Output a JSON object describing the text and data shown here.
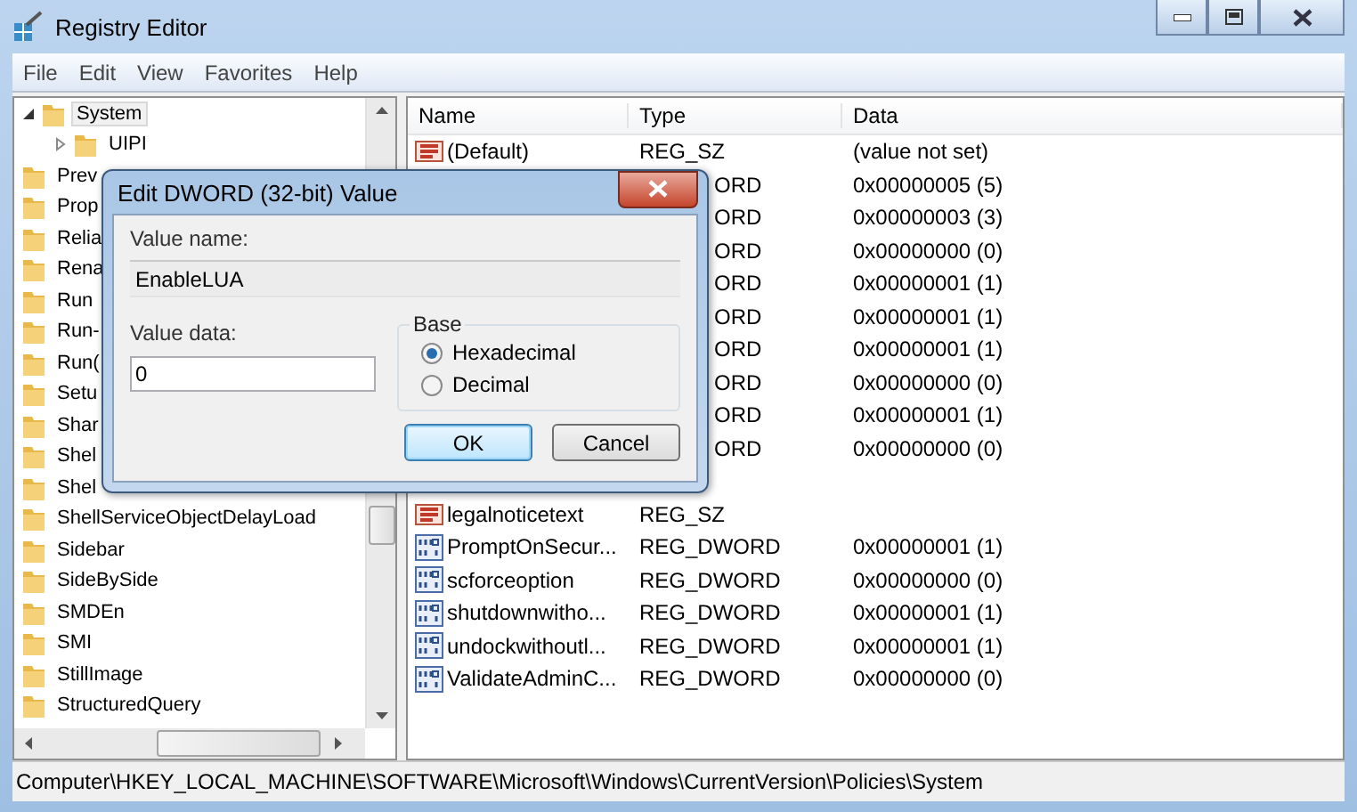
{
  "window": {
    "title": "Registry Editor"
  },
  "menu": [
    "File",
    "Edit",
    "View",
    "Favorites",
    "Help"
  ],
  "tree": {
    "items": [
      {
        "label": "System",
        "selected": true,
        "expanded": true,
        "children": [
          {
            "label": "UIPI",
            "selected": false,
            "expanded": false
          }
        ]
      },
      {
        "label": "Prev",
        "selected": false
      },
      {
        "label": "Prop",
        "selected": false
      },
      {
        "label": "Relia",
        "selected": false
      },
      {
        "label": "Rena",
        "selected": false
      },
      {
        "label": "Run",
        "selected": false
      },
      {
        "label": "Run-",
        "selected": false
      },
      {
        "label": "Run(",
        "selected": false
      },
      {
        "label": "Setu",
        "selected": false
      },
      {
        "label": "Shar",
        "selected": false
      },
      {
        "label": "Shel",
        "selected": false
      },
      {
        "label": "Shel",
        "selected": false
      },
      {
        "label": "ShellServiceObjectDelayLoad",
        "selected": false
      },
      {
        "label": "Sidebar",
        "selected": false
      },
      {
        "label": "SideBySide",
        "selected": false
      },
      {
        "label": "SMDEn",
        "selected": false
      },
      {
        "label": "SMI",
        "selected": false
      },
      {
        "label": "StillImage",
        "selected": false
      },
      {
        "label": "StructuredQuery",
        "selected": false
      }
    ]
  },
  "list": {
    "columns": [
      "Name",
      "Type",
      "Data"
    ],
    "rows": [
      {
        "kind": "string",
        "name": "(Default)",
        "type": "REG_SZ",
        "data": "(value not set)"
      },
      {
        "kind": "covered",
        "type": "ORD",
        "data": "0x00000005 (5)"
      },
      {
        "kind": "covered",
        "type": "ORD",
        "data": "0x00000003 (3)"
      },
      {
        "kind": "covered",
        "type": "ORD",
        "data": "0x00000000 (0)"
      },
      {
        "kind": "covered",
        "type": "ORD",
        "data": "0x00000001 (1)"
      },
      {
        "kind": "covered",
        "type": "ORD",
        "data": "0x00000001 (1)"
      },
      {
        "kind": "covered",
        "type": "ORD",
        "data": "0x00000001 (1)"
      },
      {
        "kind": "covered",
        "type": "ORD",
        "data": "0x00000000 (0)"
      },
      {
        "kind": "covered",
        "type": "ORD",
        "data": "0x00000001 (1)"
      },
      {
        "kind": "covered",
        "type": "ORD",
        "data": "0x00000000 (0)"
      },
      {
        "kind": "string",
        "name": "legalnoticetext",
        "type": "REG_SZ"
      },
      {
        "kind": "dword",
        "name": "PromptOnSecur...",
        "type": "REG_DWORD",
        "data": "0x00000001 (1)"
      },
      {
        "kind": "dword",
        "name": "scforceoption",
        "type": "REG_DWORD",
        "data": "0x00000000 (0)"
      },
      {
        "kind": "dword",
        "name": "shutdownwitho...",
        "type": "REG_DWORD",
        "data": "0x00000001 (1)"
      },
      {
        "kind": "dword",
        "name": "undockwithoutl...",
        "type": "REG_DWORD",
        "data": "0x00000001 (1)"
      },
      {
        "kind": "dword",
        "name": "ValidateAdminC...",
        "type": "REG_DWORD",
        "data": "0x00000000 (0)"
      }
    ]
  },
  "status_bar": "Computer\\HKEY_LOCAL_MACHINE\\SOFTWARE\\Microsoft\\Windows\\CurrentVersion\\Policies\\System",
  "dialog": {
    "title": "Edit DWORD (32-bit) Value",
    "value_name_label": "Value name:",
    "value_name": "EnableLUA",
    "value_data_label": "Value data:",
    "value_data": "0",
    "base": {
      "label": "Base",
      "options": [
        {
          "label": "Hexadecimal",
          "selected": true
        },
        {
          "label": "Decimal",
          "selected": false
        }
      ]
    },
    "buttons": [
      {
        "label": "OK",
        "default": true
      },
      {
        "label": "Cancel",
        "default": false
      }
    ]
  }
}
